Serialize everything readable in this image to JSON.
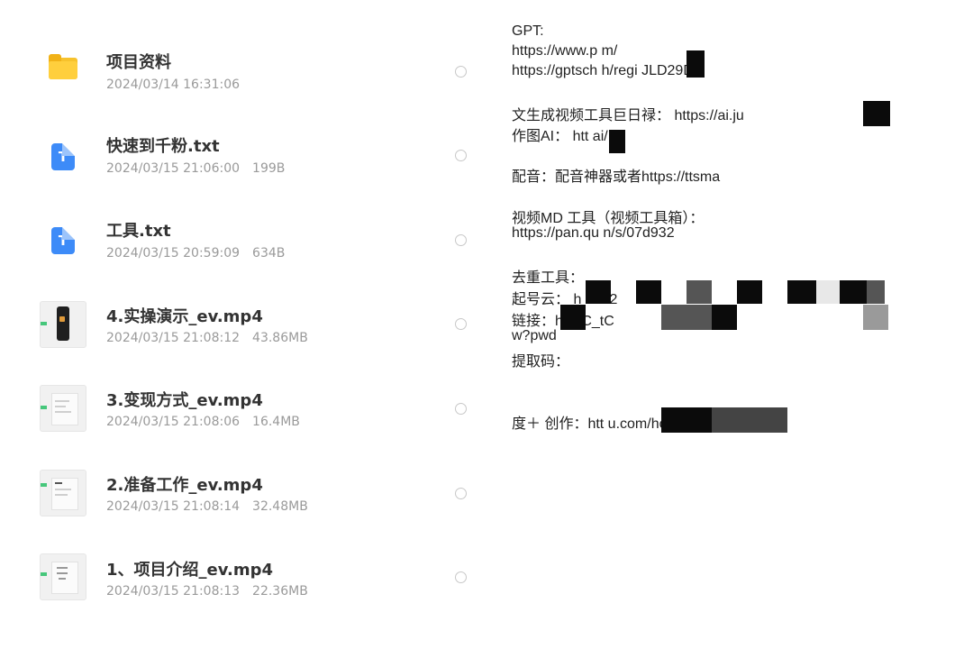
{
  "files": [
    {
      "name": "项目资料",
      "date": "2024/03/14 16:31:06",
      "size": "",
      "type": "folder"
    },
    {
      "name": "快速到千粉.txt",
      "date": "2024/03/15 21:06:00",
      "size": "199B",
      "type": "txt"
    },
    {
      "name": "工具.txt",
      "date": "2024/03/15 20:59:09",
      "size": "634B",
      "type": "txt"
    },
    {
      "name": "4.实操演示_ev.mp4",
      "date": "2024/03/15 21:08:12",
      "size": "43.86MB",
      "type": "video"
    },
    {
      "name": "3.变现方式_ev.mp4",
      "date": "2024/03/15 21:08:06",
      "size": "16.4MB",
      "type": "video"
    },
    {
      "name": "2.准备工作_ev.mp4",
      "date": "2024/03/15 21:08:14",
      "size": "32.48MB",
      "type": "video"
    },
    {
      "name": "1、项目介绍_ev.mp4",
      "date": "2024/03/15 21:08:13",
      "size": "22.36MB",
      "type": "video"
    }
  ],
  "text_lines": [
    "GPT:",
    "https://www.p                    m/",
    "https://gptsch                    h/regi                                   JLD29DS",
    "文生成视频工具巨日禄：  https://ai.ju",
    "作图AI：  htt                         ai/",
    "配音：配音神器或者https://ttsma",
    "视频MD 工具（视频工具箱）：",
    "https://pan.qu           n/s/07d932",
    "去重工具：",
    "起号云：  h                                                                           3002",
    "链接：h                                                                              JcC_tC",
    "w?pwd",
    "提取码：",
    "度＋ 创作：htt                         u.com/home"
  ],
  "colors": {
    "folder": "#f7c22c",
    "txt_icon": "#3d8bf8",
    "meta_text": "#9a9a9a",
    "video_accent": "#46c77b"
  }
}
